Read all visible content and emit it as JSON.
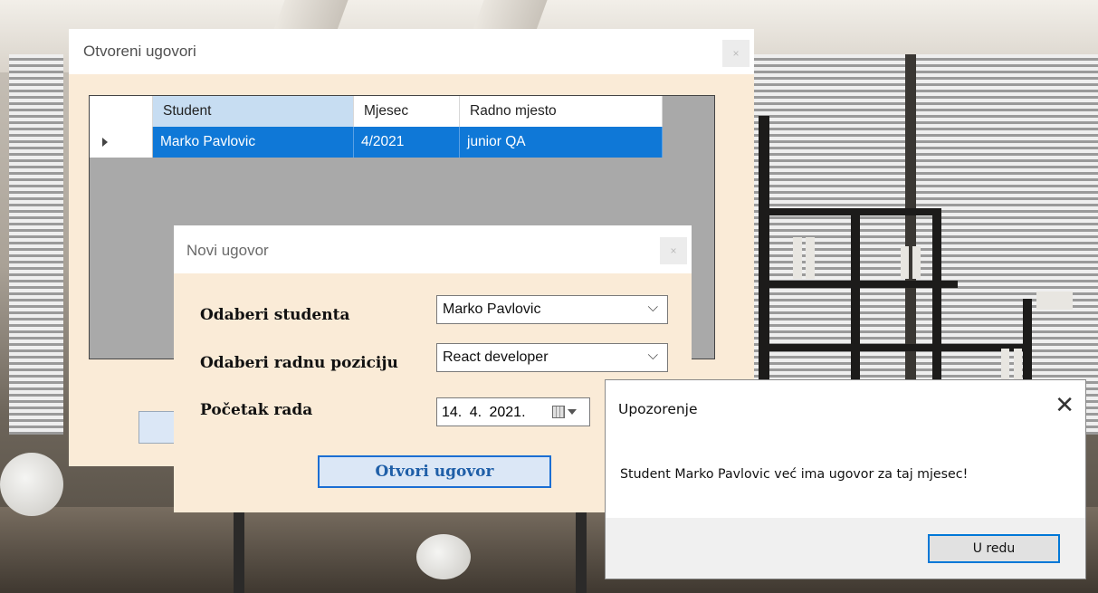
{
  "main_window": {
    "title": "Otvoreni ugovori",
    "close_glyph": "×",
    "grid": {
      "columns": [
        "Student",
        "Mjesec",
        "Radno mjesto"
      ],
      "rows": [
        {
          "student": "Marko Pavlovic",
          "mjesec": "4/2021",
          "radno_mjesto": "junior QA",
          "selected": true
        }
      ]
    }
  },
  "new_contract_dialog": {
    "title": "Novi ugovor",
    "close_glyph": "×",
    "student_label": "Odaberi studenta",
    "student_value": "Marko Pavlovic",
    "position_label": "Odaberi radnu poziciju",
    "position_value": "React developer",
    "start_label": "Početak rada",
    "start_value": "14.  4. 2021.",
    "open_button": "Otvori ugovor"
  },
  "warning_box": {
    "title": "Upozorenje",
    "close_glyph": "✕",
    "message": "Student Marko Pavlovic već ima ugovor za taj mjesec!",
    "ok_button": "U redu"
  },
  "colors": {
    "form_background": "#faebd7",
    "selection_blue": "#0f78d7",
    "button_fill": "#dbe7f6",
    "focus_border": "#0078d7"
  },
  "icons": [
    "chevron-down-icon",
    "calendar-icon",
    "row-arrow-icon",
    "close-icon"
  ]
}
